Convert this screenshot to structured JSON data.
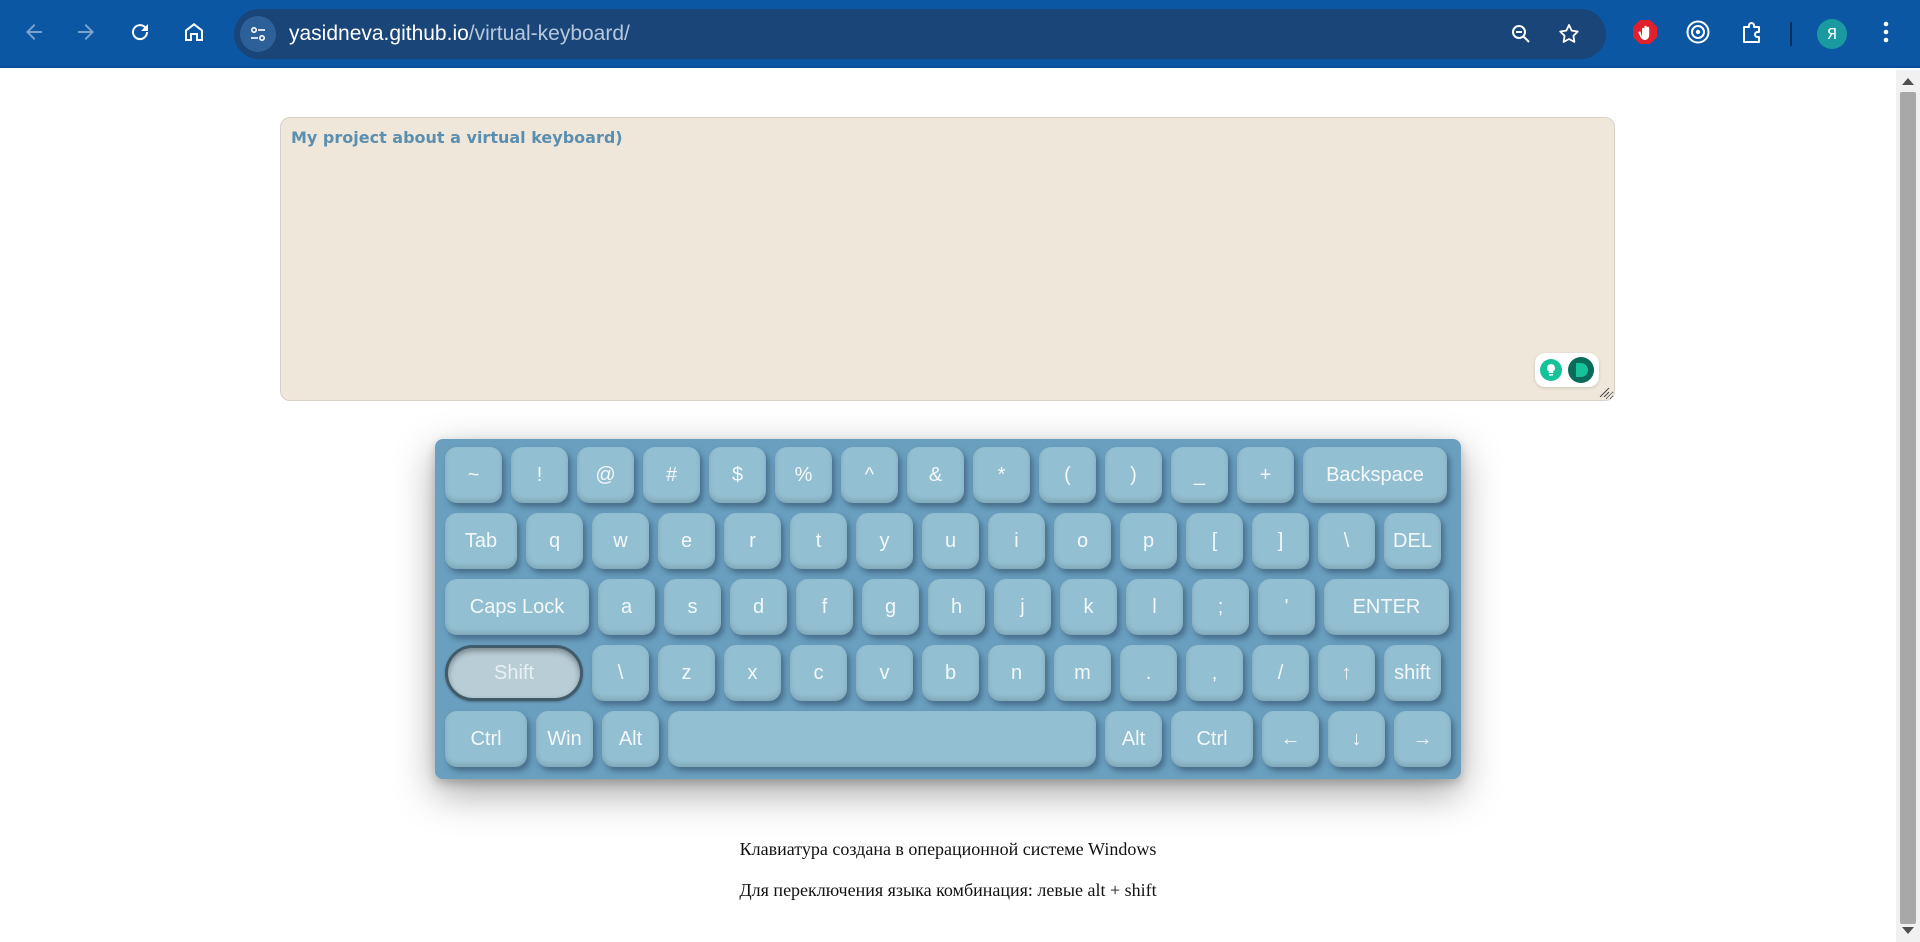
{
  "browser": {
    "url_host": "yasidneva.github.io",
    "url_path": "/virtual-keyboard/",
    "profile_initial": "Я",
    "icons": [
      "back-icon",
      "forward-icon",
      "reload-icon",
      "home-icon",
      "site-info-icon",
      "zoom-icon",
      "bookmark-star-icon",
      "extension-stop-icon",
      "extension-target-icon",
      "extensions-puzzle-icon",
      "menu-kebab-icon"
    ],
    "colors": {
      "toolbar": "#0b57a4",
      "omnibox": "#1a4578"
    }
  },
  "textarea": {
    "value": "My project about a virtual keyboard)"
  },
  "keyboard": {
    "colors": {
      "body": "#6a9fbf",
      "key": "#92bfd1",
      "key_text": "#f4f8fa",
      "active_key": "#b9cdd6"
    },
    "active_key": "Shift",
    "rows": [
      [
        "~",
        "!",
        "@",
        "#",
        "$",
        "%",
        "^",
        "&",
        "*",
        "(",
        ")",
        "_",
        "+",
        "Backspace"
      ],
      [
        "Tab",
        "q",
        "w",
        "e",
        "r",
        "t",
        "y",
        "u",
        "i",
        "o",
        "p",
        "[",
        "]",
        "\\",
        "DEL"
      ],
      [
        "Caps Lock",
        "a",
        "s",
        "d",
        "f",
        "g",
        "h",
        "j",
        "k",
        "l",
        ";",
        "'",
        "ENTER"
      ],
      [
        "Shift",
        "\\",
        "z",
        "x",
        "c",
        "v",
        "b",
        "n",
        "m",
        ".",
        ",",
        "/",
        "↑",
        "shift"
      ],
      [
        "Ctrl",
        "Win",
        "Alt",
        "",
        "Alt",
        "Ctrl",
        "←",
        "↓",
        "→"
      ]
    ]
  },
  "info": {
    "line1": "Клавиатура создана в операционной системе Windows",
    "line2": "Для переключения языка комбинация: левые alt + shift"
  }
}
